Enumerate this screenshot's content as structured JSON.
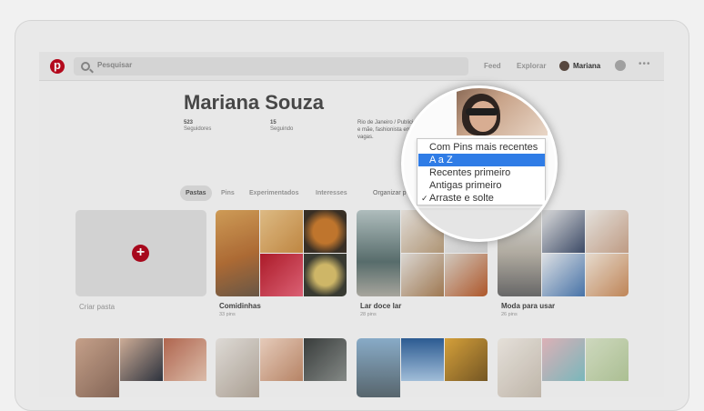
{
  "topbar": {
    "search_placeholder": "Pesquisar",
    "feed_label": "Feed",
    "explore_label": "Explorar",
    "user_name": "Mariana"
  },
  "profile": {
    "name": "Mariana Souza",
    "stats": [
      {
        "value": "523",
        "label": "Seguidores"
      },
      {
        "value": "15",
        "label": "Seguindo"
      }
    ],
    "bio_lines": [
      "Rio de Janeiro / Publicid",
      "e mãe, fashionista em",
      "vagas."
    ]
  },
  "tabs": [
    {
      "label": "Pastas",
      "active": true
    },
    {
      "label": "Pins",
      "active": false
    },
    {
      "label": "Experimentados",
      "active": false
    },
    {
      "label": "Interesses",
      "active": false
    }
  ],
  "organize_label": "Organizar p",
  "sort_menu": {
    "items": [
      {
        "label": "Com Pins mais recentes",
        "selected": false,
        "checked": false
      },
      {
        "label": "A a Z",
        "selected": true,
        "checked": false
      },
      {
        "label": "Recentes primeiro",
        "selected": false,
        "checked": false
      },
      {
        "label": "Antigas primeiro",
        "selected": false,
        "checked": false
      },
      {
        "label": "Arraste e solte",
        "selected": false,
        "checked": true
      }
    ],
    "check_glyph": "✓",
    "highlight_color": "#2f7ce6"
  },
  "create_board": {
    "plus": "+",
    "label": "Criar pasta"
  },
  "boards": [
    {
      "title": "Comidinhas",
      "count": "33 pins"
    },
    {
      "title": "Lar doce lar",
      "count": "28 pins"
    },
    {
      "title": "Moda para usar",
      "count": "26 pins"
    }
  ],
  "colors": {
    "brand": "#bd081c"
  }
}
